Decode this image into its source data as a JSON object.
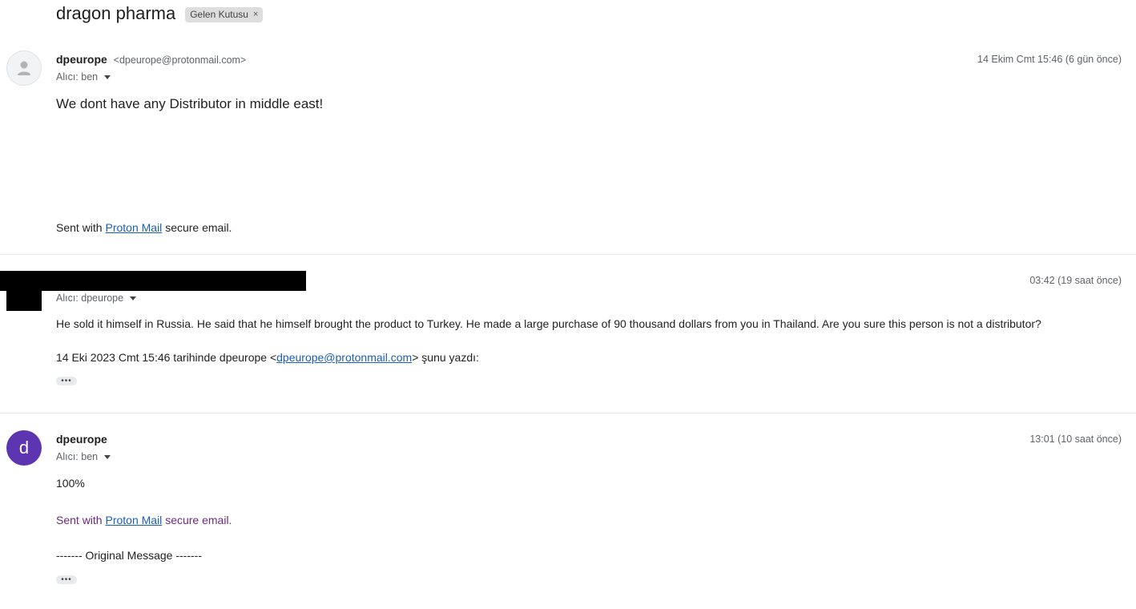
{
  "subject": {
    "title": "dragon pharma",
    "label": "Gelen Kutusu",
    "label_remove": "×"
  },
  "messages": [
    {
      "sender_name": "dpeurope",
      "sender_email": "<dpeurope@protonmail.com>",
      "date": "14 Ekim Cmt 15:46 (6 gün önce)",
      "recipient": "Alıcı: ben",
      "avatar": "person-icon",
      "body": "We dont have any Distributor in middle east!",
      "signature_prefix": "Sent with",
      "signature_link": "Proton Mail",
      "signature_suffix": "secure email."
    },
    {
      "sender_name": "",
      "date": "03:42 (19 saat önce)",
      "recipient": "Alıcı: dpeurope",
      "body": "He sold it himself in Russia. He said that he himself brought the product to Turkey. He made a large purchase of 90 thousand dollars from you in Thailand. Are you sure this person is not a distributor?",
      "quote_prefix": "14 Eki 2023 Cmt 15:46 tarihinde dpeurope <",
      "quote_link": "dpeurope@protonmail.com",
      "quote_suffix": "> şunu yazdı:",
      "more": "•••"
    },
    {
      "sender_name": "dpeurope",
      "date": "13:01 (10 saat önce)",
      "recipient": "Alıcı: ben",
      "avatar_letter": "d",
      "body": "100%",
      "signature_prefix": "Sent with",
      "signature_link": "Proton Mail",
      "signature_suffix": "secure email.",
      "original": "------- Original Message -------",
      "more": "•••"
    }
  ],
  "colors": {
    "avatar_purple": "#5e35b1",
    "link_blue": "#1a5fb4",
    "signature_purple": "#6b2a7a"
  }
}
